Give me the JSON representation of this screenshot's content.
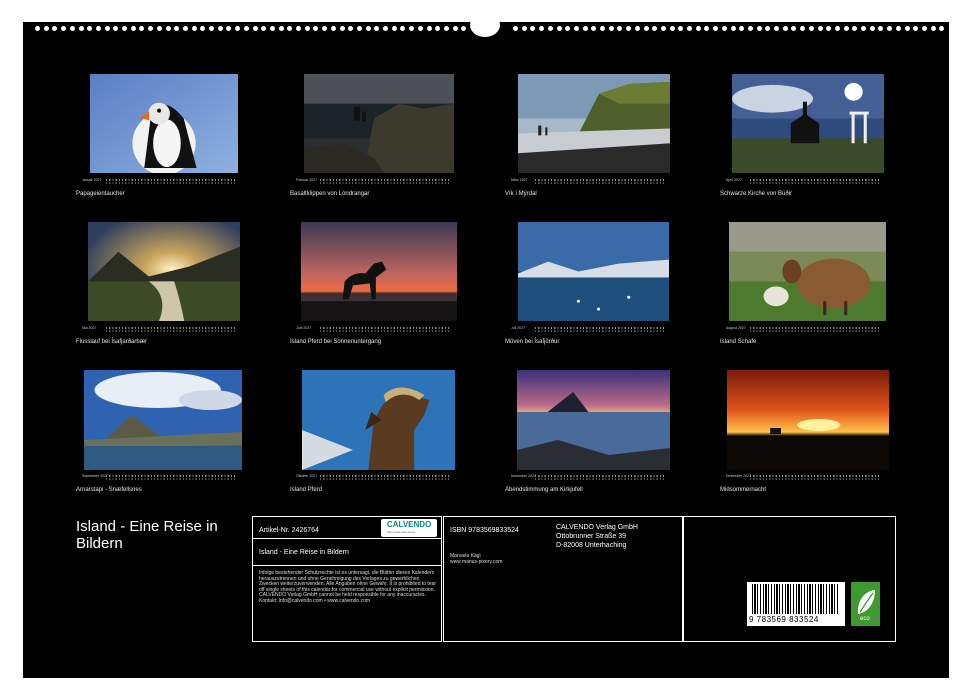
{
  "photos": [
    {
      "month": "Januar 2027",
      "caption": "Papageientaucher"
    },
    {
      "month": "Februar 2027",
      "caption": "Basaltklippen von Lóndrangar"
    },
    {
      "month": "März 2027",
      "caption": "Vík í Mýrdal"
    },
    {
      "month": "April 2027",
      "caption": "Schwarze Kirche von Búðir"
    },
    {
      "month": "Mai 2027",
      "caption": "Flusslauf bei Ísafjarðarbær"
    },
    {
      "month": "Juni 2027",
      "caption": "Island Pferd bei Sonnenuntergang"
    },
    {
      "month": "Juli 2027",
      "caption": "Möven bei Ísafjörður"
    },
    {
      "month": "August 2027",
      "caption": "Island Schafe"
    },
    {
      "month": "September 2027",
      "caption": "Arnarstapi - Snæfellsnes"
    },
    {
      "month": "Oktober 2027",
      "caption": "Island Pferd"
    },
    {
      "month": "November 2027",
      "caption": "Abendstimmung am Kirkjufell"
    },
    {
      "month": "Dezember 2027",
      "caption": "Midsommernacht"
    }
  ],
  "info": {
    "title": "Island - Eine Reise in Bildern",
    "article": "Artikel-Nr. 2426764",
    "logo_name": "CALVENDO",
    "logo_sub": "Mein Kalenderverlag",
    "subtitle": "Island - Eine Reise in Bildern",
    "legal": "Infolge bestehender Schutzrechte ist es untersagt, die Blätter dieses Kalenders herauszutrennen und ohne Genehmigung des Verlages zu gewerblichen Zwecken weiterzuverwenden. Alle Angaben ohne Gewähr. It is prohibited to tear off single sheets of this calendar for commercial use without explicit permission. CALVENDO Verlag GmbH cannot be held responsible for any inaccuracies. Kontakt: info@calvendo.com • www.calvendo.com",
    "isbn": "ISBN 9783569833524",
    "publisher_name": "CALVENDO Verlag GmbH",
    "publisher_street": "Ottobrunner Straße 39",
    "publisher_city": "D-82008 Unterhaching",
    "author": "Manuela Kägi",
    "author_site": "www.manus-pixery.com",
    "barcode_number": "9 783569 833524",
    "eco_label": "eco"
  }
}
